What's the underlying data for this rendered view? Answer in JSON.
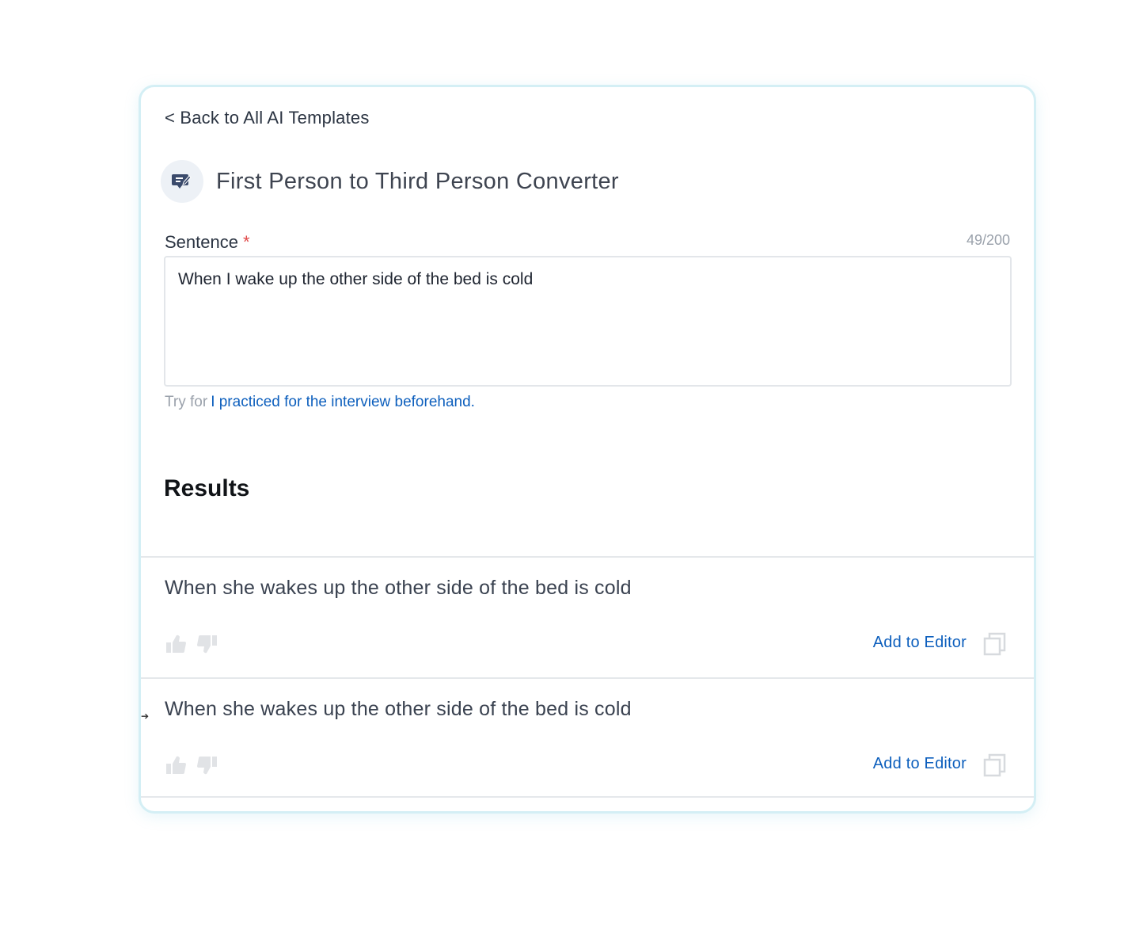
{
  "nav": {
    "back_label": "< Back to All AI Templates"
  },
  "template": {
    "title": "First Person to Third Person Converter",
    "icon": "chat-bubble-edit-icon"
  },
  "form": {
    "sentence_label": "Sentence",
    "required_mark": "*",
    "char_count": "49/200",
    "sentence_value": "When I wake up the other side of the bed is cold",
    "try_prefix": "Try for",
    "try_example": "I practiced for the interview beforehand."
  },
  "results": {
    "heading": "Results",
    "items": [
      {
        "text": "When she wakes up the other side of the bed is cold",
        "add_label": "Add to Editor"
      },
      {
        "text": "When she wakes up the other side of the bed is cold",
        "add_label": "Add to Editor"
      }
    ]
  },
  "colors": {
    "card_border": "#d4eff5",
    "link_blue": "#0d5fbd",
    "required_red": "#e04848",
    "muted_gray": "#9aa1ab",
    "icon_bg": "#edf1f6",
    "icon_fg": "#3a4a6b"
  }
}
